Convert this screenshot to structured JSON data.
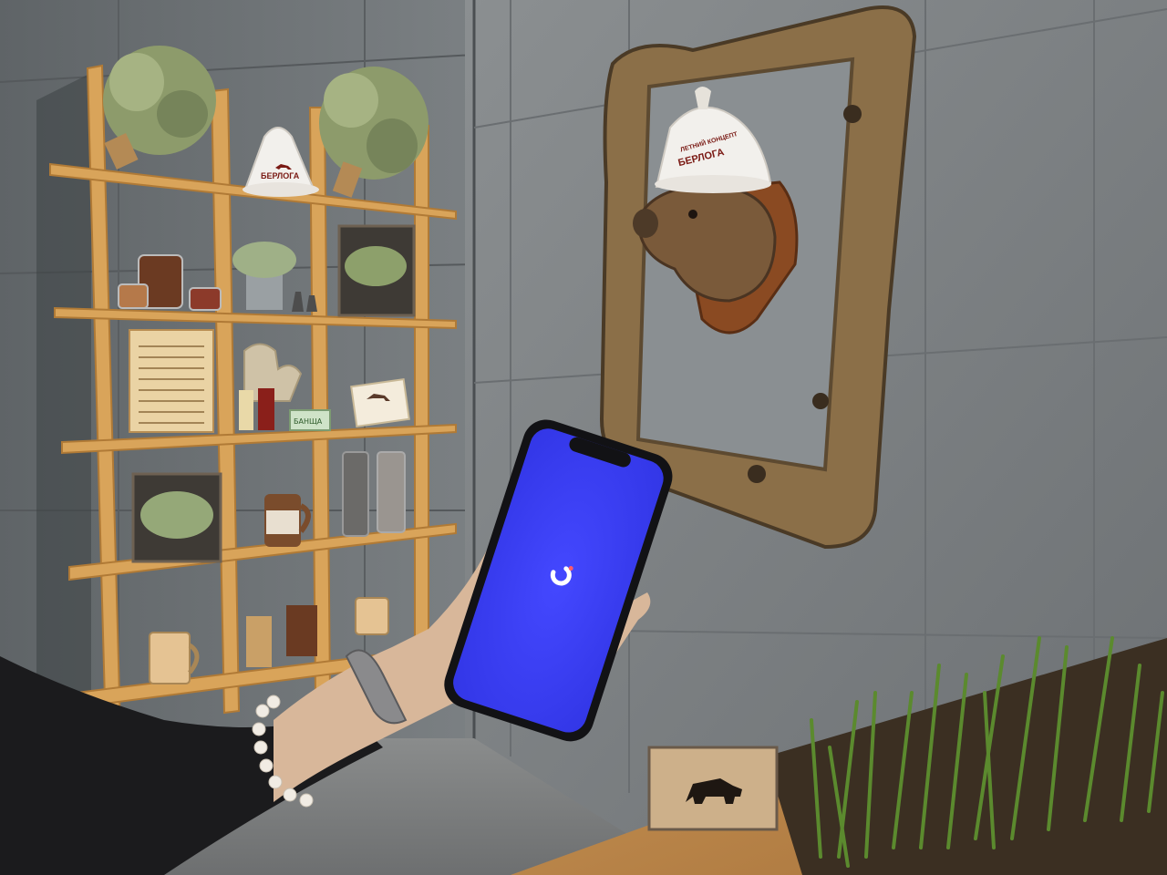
{
  "scene": {
    "hat_brand_text": "БЕРЛОГА",
    "hat_tagline_text": "ЛЕТНИЙ КОНЦЕПТ",
    "shop_card_text": "БЕРЛОГА",
    "soap_label_text": "БАНЩА"
  },
  "phone": {
    "screen_color": "#3b3ff0",
    "state": "loading",
    "icon": "loading-spinner-icon"
  },
  "colors": {
    "wall": "#7d8285",
    "shelf_wood": "#d9a45a",
    "frame_wood": "#8b6f48",
    "screen": "#3b3ff0"
  }
}
